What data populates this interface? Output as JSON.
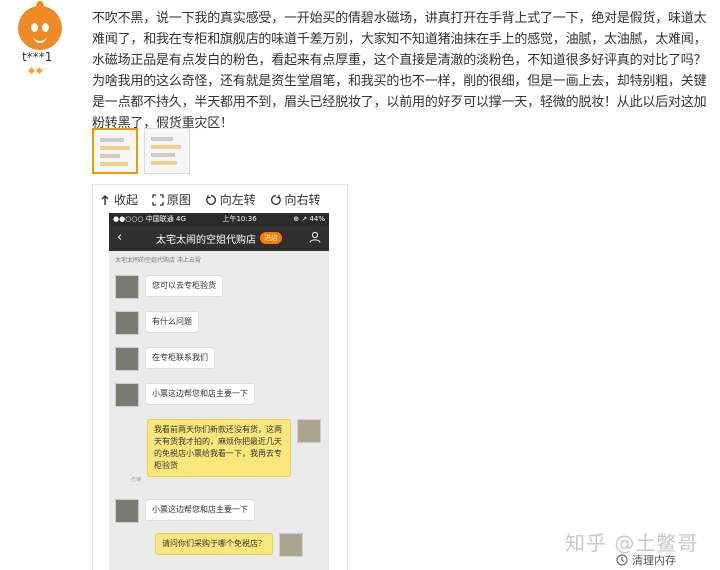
{
  "user": {
    "name": "t***1",
    "badges": "◆◆"
  },
  "review": {
    "text": "不吹不黑，说一下我的真实感受，一开始买的倩碧水磁场，讲真打开在手背上式了一下，绝对是假货，味道太难闻了，和我在专柜和旗舰店的味道千差万别，大家知不知道猪油抹在手上的感觉，油腻，太油腻，太难闻，水磁场正品是有点发白的粉色，看起来有点厚重，这个直接是清澈的淡粉色，不知道很多好评真的对比了吗？为啥我用的这么奇怪，还有就是资生堂眉笔，和我买的也不一样，削的很细，但是一画上去，却特别粗，关键是一点都不持久，半天都用不到，眉头已经脱妆了，以前用的好歹可以撑一天，轻微的脱妆！从此以后对这加粉转黑了，假货重灾区！"
  },
  "viewer": {
    "tools": {
      "collapse": "收起",
      "original": "原图",
      "rotate_left": "向左转",
      "rotate_right": "向右转"
    }
  },
  "phone": {
    "status_left": "●●○○○ 中国联通  4G",
    "status_time": "上午10:36",
    "status_right": "⊕ ↗ 44%",
    "nav_title": "太宅太闹的空姐代购店",
    "nav_enter": "进店",
    "shop_line": "太宅太闹的空姐代购店 冲上云霄",
    "messages": [
      {
        "side": "left",
        "text": "您可以去专柜验货"
      },
      {
        "side": "left",
        "text": "有什么问题"
      },
      {
        "side": "left",
        "text": "在专柜联系我们"
      },
      {
        "side": "left",
        "text": "小票这边帮您和店主要一下"
      },
      {
        "side": "right",
        "text": "我看前两天你们新款还没有货，这两天有货我才拍的，麻烦你把最近几天的免税店小票给我看一下，我再去专柜验货"
      },
      {
        "side": "left",
        "text": "小票这边帮您和店主要一下"
      },
      {
        "side": "right",
        "text": "请问你们采购于哪个免税店？"
      }
    ],
    "read_mark": "已读"
  },
  "watermark": "知乎 @土鳖哥",
  "clear_memory": "清理内存",
  "colors": {
    "accent": "#f39800",
    "avatar": "#f08a24",
    "bubble_right": "#fce77d"
  }
}
